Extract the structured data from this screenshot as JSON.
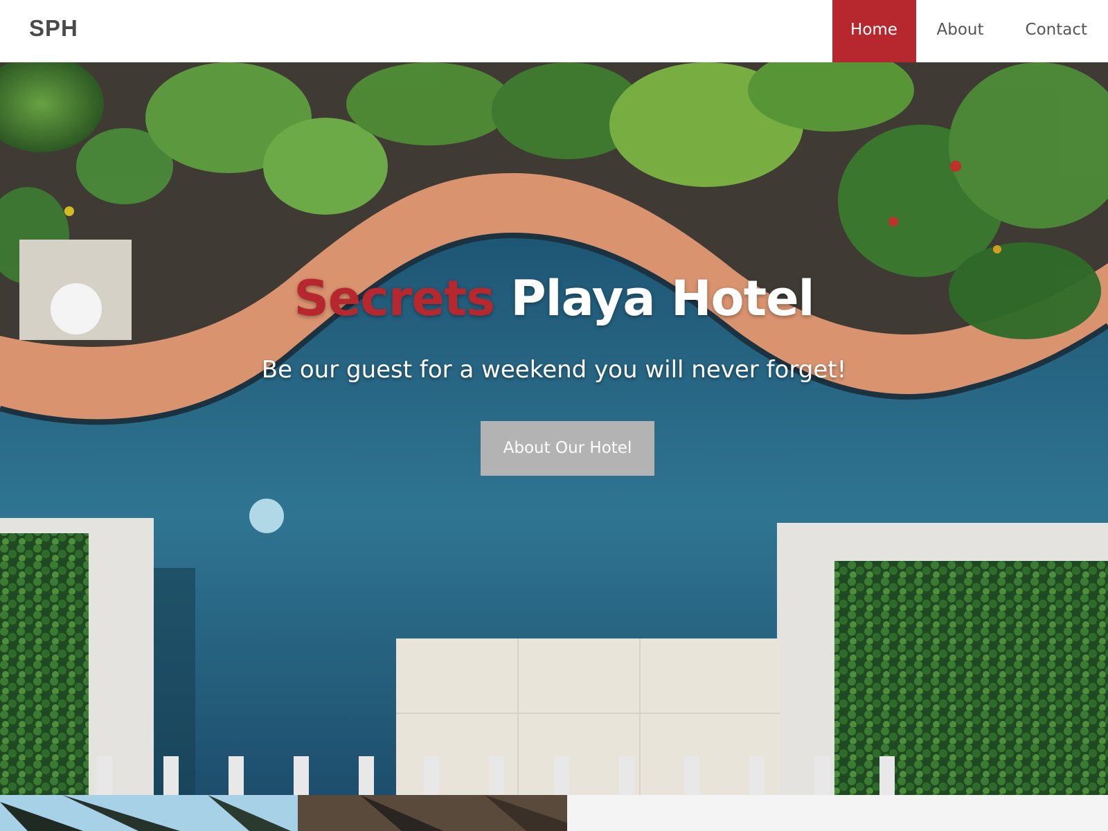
{
  "nav": {
    "brand": "SPH",
    "links": [
      {
        "label": "Home",
        "active": true
      },
      {
        "label": "About",
        "active": false
      },
      {
        "label": "Contact",
        "active": false
      }
    ]
  },
  "hero": {
    "title_accent": "Secrets",
    "title_rest": " Playa Hotel",
    "subtitle": "Be our guest for a weekend you will never forget!",
    "button_label": "About Our Hotel"
  },
  "colors": {
    "accent": "#b7282e",
    "button": "#b3b3b3",
    "pool": "#2a6683",
    "coping": "#d9936f"
  }
}
